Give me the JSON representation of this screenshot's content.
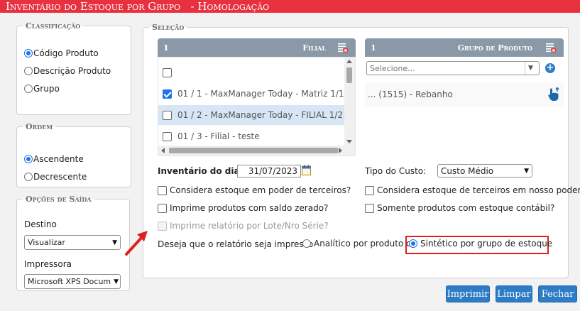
{
  "window": {
    "title": "Inventário do Estoque por Grupo   - Homologação"
  },
  "classificacao": {
    "legend": "Classificação",
    "options": [
      "Código Produto",
      "Descrição Produto",
      "Grupo"
    ],
    "selected": "Código Produto"
  },
  "ordem": {
    "legend": "Ordem",
    "options": [
      "Ascendente",
      "Decrescente"
    ],
    "selected": "Ascendente"
  },
  "opcoes_saida": {
    "legend": "Opções de Saída",
    "destino_label": "Destino",
    "destino_value": "Visualizar",
    "impressora_label": "Impressora",
    "impressora_value": "Microsoft XPS Docum"
  },
  "selecao": {
    "legend": "Seleção",
    "filial": {
      "count": "1",
      "title": "Filial",
      "rows": [
        {
          "text": "01 / 1 - MaxManager Today - Matriz 1/1",
          "checked": true
        },
        {
          "text": "01 / 2 - MaxManager Today - FILIAL 1/2",
          "checked": false
        },
        {
          "text": "01 / 3 - Filial - teste",
          "checked": false
        }
      ]
    },
    "grupo": {
      "count": "1",
      "title": "Grupo de Produto",
      "select_placeholder": "Selecione...",
      "items": [
        "... (1515) - Rebanho"
      ]
    },
    "inventario_label": "Inventário do dia:",
    "inventario_date": "31/07/2023",
    "tipo_custo_label": "Tipo do Custo:",
    "tipo_custo_value": "Custo Médio",
    "checkboxes": {
      "estoque_terceiros": "Considera estoque em poder de terceiros?",
      "estoque_nosso_poder": "Considera estoque de terceiros em nosso poder?",
      "saldo_zerado": "Imprime produtos com saldo zerado?",
      "estoque_contabil": "Somente produtos com estoque contábil?",
      "lote_serie": "Imprime relatório por Lote/Nro Série?"
    },
    "impressao_label": "Deseja que o relatório seja impresso",
    "impressao_options": [
      "Analítico por produto ou",
      "Sintético por grupo de estoque"
    ],
    "impressao_selected": "Sintético por grupo de estoque"
  },
  "buttons": {
    "imprimir": "Imprimir",
    "limpar": "Limpar",
    "fechar": "Fechar"
  },
  "colors": {
    "title_bar": "#e8313f",
    "grid_header": "#8999a8",
    "button": "#2e7cc6",
    "highlight_box": "#e02020",
    "selected_row": "#d6e6f5"
  }
}
